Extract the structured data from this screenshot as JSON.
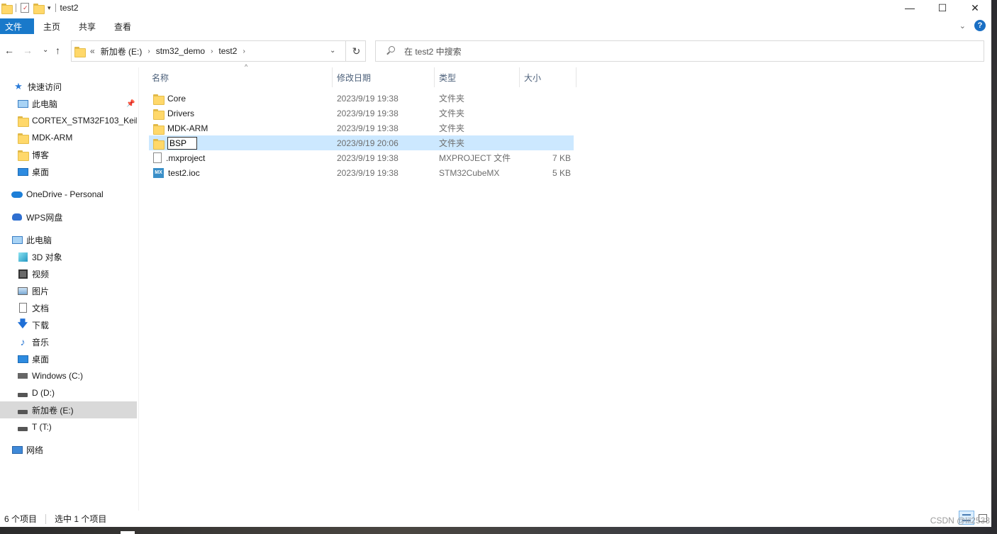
{
  "window": {
    "title": "test2"
  },
  "quick_access_toolbar": {
    "icons": [
      "folder-icon",
      "properties-icon",
      "new-folder-icon",
      "customize-dropdown-icon"
    ]
  },
  "window_buttons": {
    "minimize": "—",
    "maximize": "☐",
    "close": "✕"
  },
  "ribbon": {
    "tabs": [
      "文件",
      "主页",
      "共享",
      "查看"
    ],
    "expand_chevron": "⌄",
    "help": "?"
  },
  "nav": {
    "back": "←",
    "forward": "→",
    "recent": "⌄",
    "up": "↑",
    "refresh": "↻",
    "dropdown": "⌄"
  },
  "address": {
    "overflow": "«",
    "crumbs": [
      "新加卷 (E:)",
      "stm32_demo",
      "test2"
    ],
    "separator": "›"
  },
  "search": {
    "placeholder": "在 test2 中搜索"
  },
  "sidebar": {
    "items": [
      {
        "label": "快速访问",
        "icon": "star-icon"
      },
      {
        "label": "此电脑",
        "icon": "pc-icon",
        "pinned": true
      },
      {
        "label": "CORTEX_STM32F103_Keil",
        "icon": "folder-icon"
      },
      {
        "label": "MDK-ARM",
        "icon": "folder-icon"
      },
      {
        "label": "博客",
        "icon": "folder-icon"
      },
      {
        "label": "桌面",
        "icon": "desktop-icon"
      },
      {
        "label": "OneDrive - Personal",
        "icon": "cloud-icon"
      },
      {
        "label": "WPS网盘",
        "icon": "wps-cloud-icon"
      },
      {
        "label": "此电脑",
        "icon": "pc-icon"
      },
      {
        "label": "3D 对象",
        "icon": "cube-icon"
      },
      {
        "label": "视频",
        "icon": "video-icon"
      },
      {
        "label": "图片",
        "icon": "picture-icon"
      },
      {
        "label": "文档",
        "icon": "document-icon"
      },
      {
        "label": "下载",
        "icon": "download-icon"
      },
      {
        "label": "音乐",
        "icon": "music-icon"
      },
      {
        "label": "桌面",
        "icon": "desktop-icon"
      },
      {
        "label": "Windows (C:)",
        "icon": "windows-drive-icon"
      },
      {
        "label": "D (D:)",
        "icon": "drive-icon"
      },
      {
        "label": "新加卷 (E:)",
        "icon": "drive-icon",
        "selected": true
      },
      {
        "label": "T (T:)",
        "icon": "drive-icon"
      },
      {
        "label": "网络",
        "icon": "network-icon"
      }
    ],
    "pin_glyph": "📌"
  },
  "columns": {
    "name": "名称",
    "date": "修改日期",
    "type": "类型",
    "size": "大小",
    "sort_indicator": "^"
  },
  "files": [
    {
      "name": "Core",
      "date": "2023/9/19 19:38",
      "type": "文件夹",
      "size": "",
      "icon": "folder-icon"
    },
    {
      "name": "Drivers",
      "date": "2023/9/19 19:38",
      "type": "文件夹",
      "size": "",
      "icon": "folder-icon"
    },
    {
      "name": "MDK-ARM",
      "date": "2023/9/19 19:38",
      "type": "文件夹",
      "size": "",
      "icon": "folder-icon"
    },
    {
      "name": "BSP",
      "date": "2023/9/19 20:06",
      "type": "文件夹",
      "size": "",
      "icon": "folder-icon",
      "selected": true,
      "renaming": true
    },
    {
      "name": ".mxproject",
      "date": "2023/9/19 19:38",
      "type": "MXPROJECT 文件",
      "size": "7 KB",
      "icon": "file-icon"
    },
    {
      "name": "test2.ioc",
      "date": "2023/9/19 19:38",
      "type": "STM32CubeMX",
      "size": "5 KB",
      "icon": "stm32cubemx-icon"
    }
  ],
  "mx_icon_text": "MX",
  "status": {
    "count": "6 个项目",
    "selected": "选中 1 个项目"
  },
  "watermark": "CSDN @lil2533",
  "colors": {
    "accent": "#1979ca",
    "selection": "#cce8ff",
    "sidebar_selected": "#d9d9d9"
  }
}
